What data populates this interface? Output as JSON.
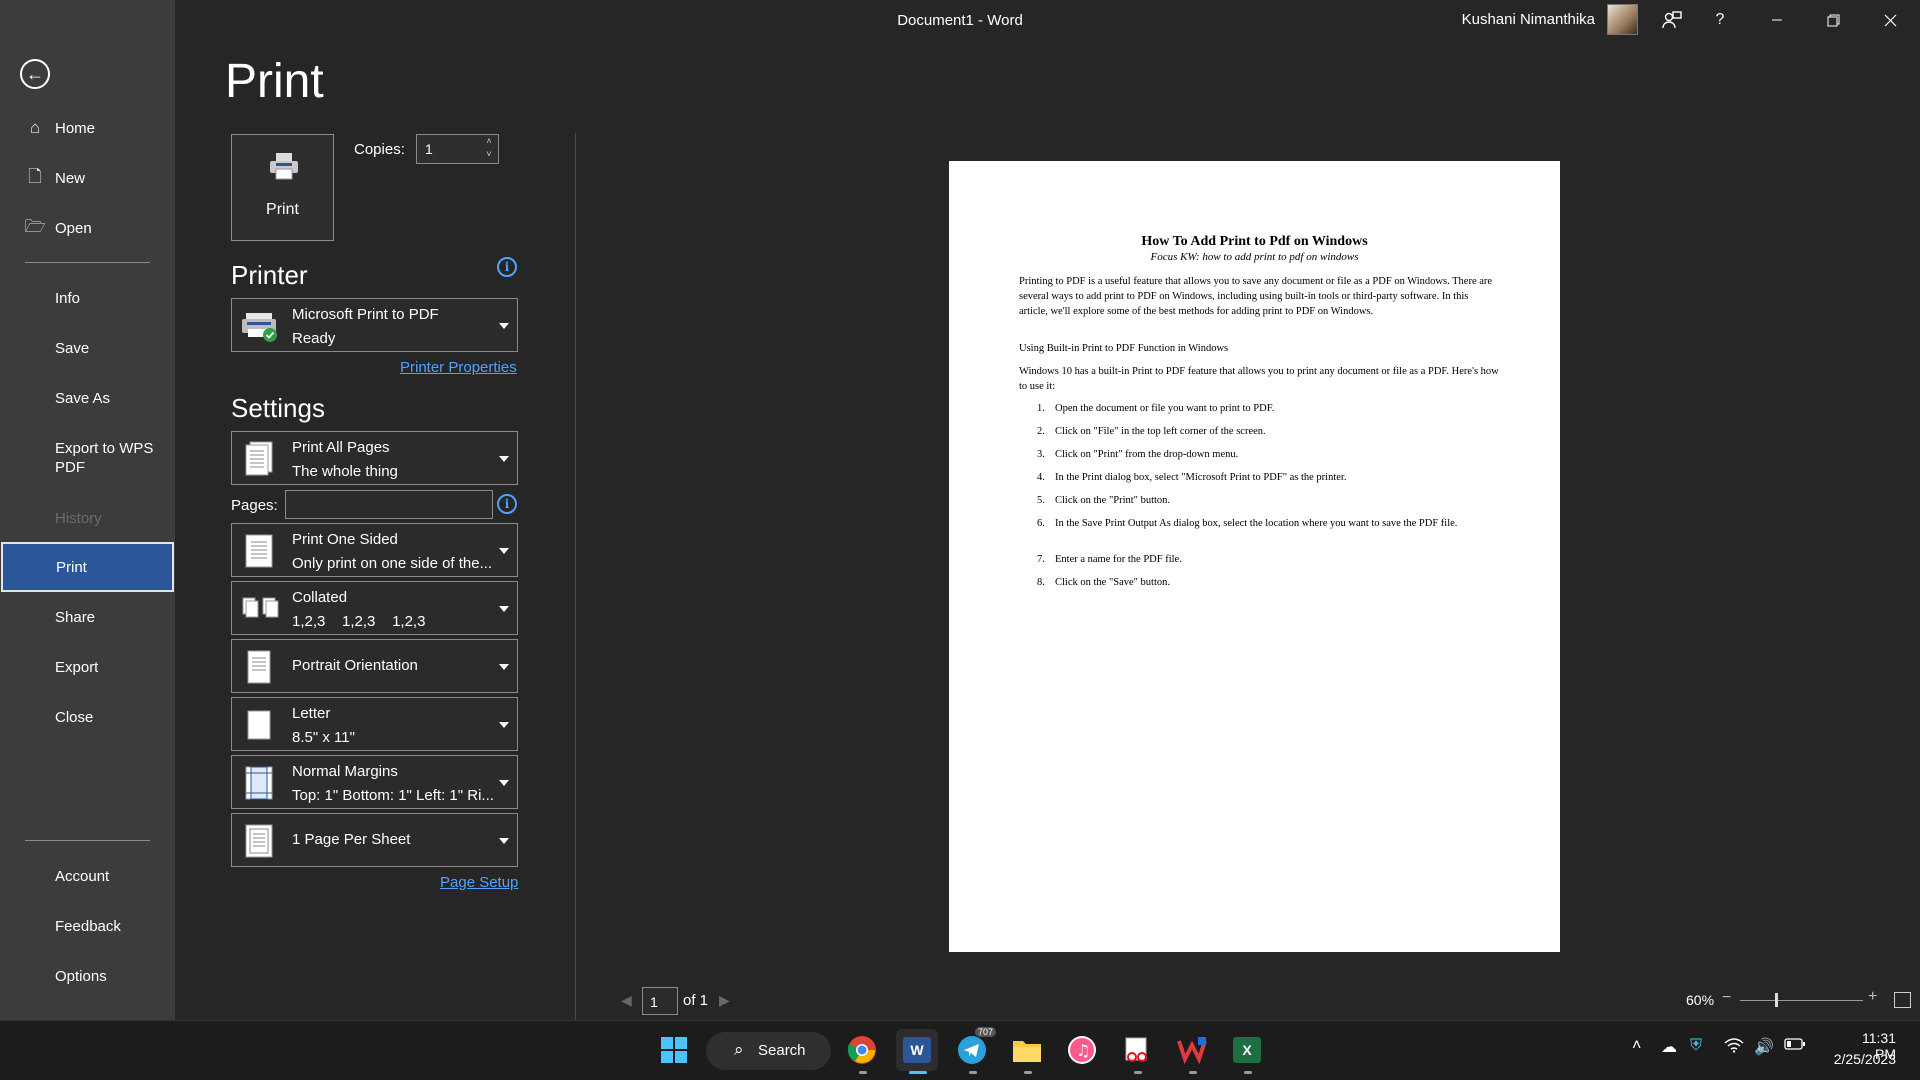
{
  "window": {
    "title": "Document1  -  Word",
    "user_name": "Kushani Nimanthika",
    "help_label": "?"
  },
  "sidebar": {
    "items": [
      {
        "label": "Home",
        "icon": "home-icon"
      },
      {
        "label": "New",
        "icon": "new-document-icon"
      },
      {
        "label": "Open",
        "icon": "folder-open-icon"
      },
      {
        "label": "Info"
      },
      {
        "label": "Save"
      },
      {
        "label": "Save As"
      },
      {
        "label": "Export to WPS PDF"
      },
      {
        "label": "History"
      },
      {
        "label": "Print"
      },
      {
        "label": "Share"
      },
      {
        "label": "Export"
      },
      {
        "label": "Close"
      },
      {
        "label": "Account"
      },
      {
        "label": "Feedback"
      },
      {
        "label": "Options"
      }
    ]
  },
  "print_panel": {
    "title": "Print",
    "print_button": "Print",
    "copies_label": "Copies:",
    "copies_value": "1",
    "printer_heading": "Printer",
    "printer_name": "Microsoft Print to PDF",
    "printer_status": "Ready",
    "printer_properties_link": "Printer Properties",
    "settings_heading": "Settings",
    "pages_label": "Pages:",
    "settings": [
      {
        "line1": "Print All Pages",
        "line2": "The whole thing"
      },
      {
        "line1": "Print One Sided",
        "line2": "Only print on one side of the..."
      },
      {
        "line1": "Collated",
        "line2": "1,2,3    1,2,3    1,2,3"
      },
      {
        "line1": "Portrait Orientation"
      },
      {
        "line1": "Letter",
        "line2": "8.5\" x 11\""
      },
      {
        "line1": "Normal Margins",
        "line2": "Top: 1\" Bottom: 1\" Left: 1\" Ri..."
      },
      {
        "line1": "1 Page Per Sheet"
      }
    ],
    "page_setup_link": "Page Setup"
  },
  "preview": {
    "heading": "How To Add Print to Pdf on Windows",
    "subheading": "Focus KW: how to add print to pdf on windows",
    "intro": "Printing to PDF is a useful feature that allows you to save any document or file as a PDF on Windows. There are several ways to add print to PDF on Windows, including using built-in tools or third-party software. In this article, we'll explore some of the best methods for adding print to PDF on Windows.",
    "section": "Using Built-in Print to PDF Function in Windows",
    "section_intro": "Windows 10 has a built-in Print to PDF feature that allows you to print any document or file as a PDF. Here's how to use it:",
    "steps": [
      {
        "num": "1.",
        "text": "Open the document or file you want to print to PDF."
      },
      {
        "num": "2.",
        "text": "Click on \"File\" in the top left corner of the screen."
      },
      {
        "num": "3.",
        "text": "Click on \"Print\" from the drop-down menu."
      },
      {
        "num": "4.",
        "text": "In the Print dialog box, select \"Microsoft Print to PDF\" as the printer."
      },
      {
        "num": "5.",
        "text": "Click on the \"Print\" button."
      },
      {
        "num": "6.",
        "text": "In the Save Print Output As dialog box, select the location where you want to save the PDF file."
      },
      {
        "num": "7.",
        "text": "Enter a name for the PDF file."
      },
      {
        "num": "8.",
        "text": "Click on the \"Save\" button."
      }
    ],
    "page_current": "1",
    "page_of": "of 1",
    "zoom": "60%"
  },
  "taskbar": {
    "search_label": "Search",
    "telegram_badge": "707",
    "time": "11:31 PM",
    "date": "2/25/2023"
  },
  "colors": {
    "sidebar_bg": "#3c3c3c",
    "main_bg": "#262626",
    "accent": "#2b579a",
    "link": "#4fa3ff"
  }
}
